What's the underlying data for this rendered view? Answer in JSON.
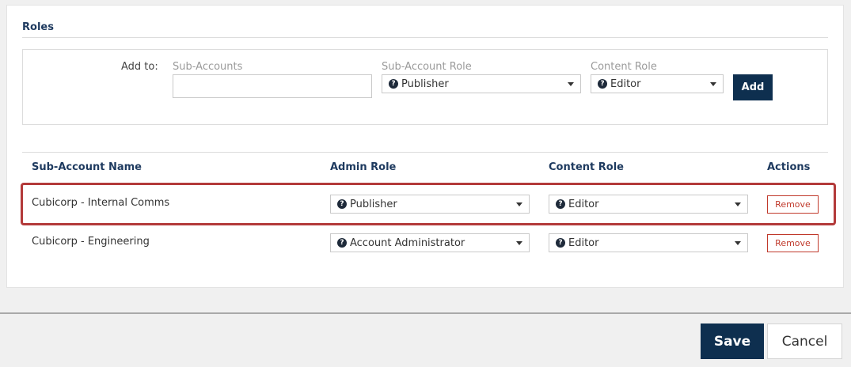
{
  "roles": {
    "title": "Roles",
    "add_form": {
      "add_to_label": "Add to:",
      "sub_accounts_label": "Sub-Accounts",
      "sub_accounts_value": "",
      "sub_account_role_label": "Sub-Account Role",
      "sub_account_role_value": "Publisher",
      "content_role_label": "Content Role",
      "content_role_value": "Editor",
      "add_button": "Add"
    },
    "table": {
      "columns": [
        "Sub-Account Name",
        "Admin Role",
        "Content Role",
        "Actions"
      ],
      "rows": [
        {
          "name": "Cubicorp - Internal Comms",
          "admin_role": "Publisher",
          "content_role": "Editor",
          "action": "Remove",
          "highlighted": true
        },
        {
          "name": "Cubicorp - Engineering",
          "admin_role": "Account Administrator",
          "content_role": "Editor",
          "action": "Remove",
          "highlighted": false
        }
      ]
    }
  },
  "footer": {
    "save": "Save",
    "cancel": "Cancel"
  },
  "icons": {
    "help": "question-circle-icon",
    "dropdown": "caret-down-icon"
  },
  "colors": {
    "navy": "#0e2f4f",
    "heading": "#1e3a5f",
    "remove": "#c0392b",
    "highlight": "#b33a3a"
  }
}
